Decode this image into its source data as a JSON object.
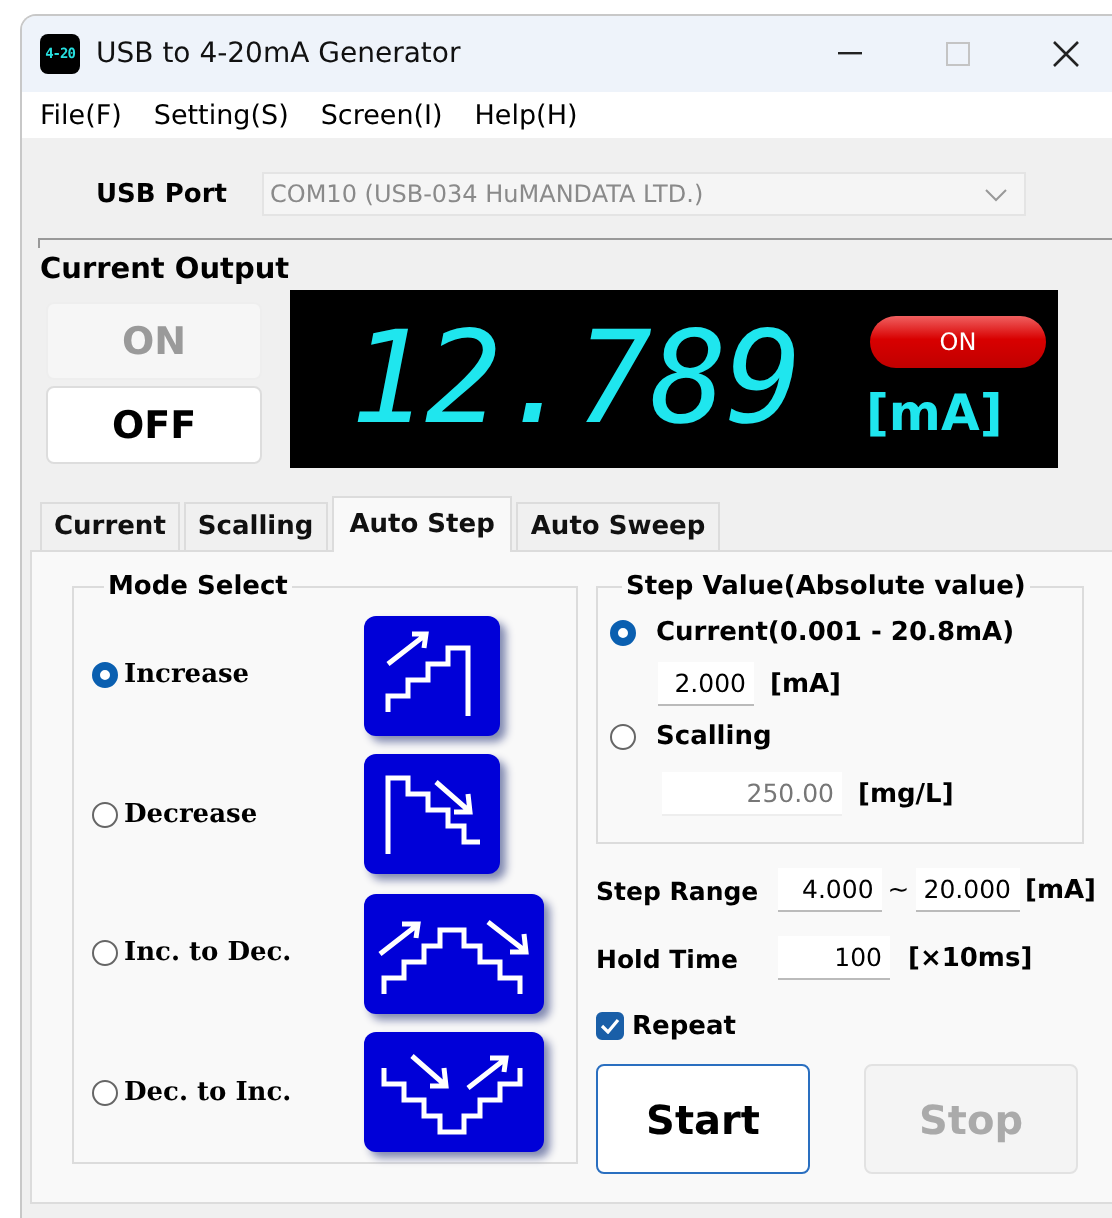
{
  "window": {
    "title": "USB to 4-20mA Generator",
    "icon_text": "4-20"
  },
  "menu": [
    "File(F)",
    "Setting(S)",
    "Screen(I)",
    "Help(H)"
  ],
  "usb_port": {
    "label": "USB Port",
    "value": "COM10 (USB-034 HuMANDATA LTD.)"
  },
  "current_output": {
    "title": "Current Output",
    "buttons": [
      {
        "label": "ON",
        "disabled": true
      },
      {
        "label": "OFF",
        "disabled": false
      }
    ],
    "display": {
      "value": "12.789",
      "unit": "[mA]",
      "indicator": {
        "label": "ON",
        "on": true
      }
    }
  },
  "tabs": [
    {
      "label": "Current",
      "selected": false
    },
    {
      "label": "Scalling",
      "selected": false
    },
    {
      "label": "Auto Step",
      "selected": true
    },
    {
      "label": "Auto Sweep",
      "selected": false
    }
  ],
  "mode_select": {
    "title": "Mode Select",
    "options": [
      {
        "label": "Increase",
        "selected": true,
        "kind": "up"
      },
      {
        "label": "Decrease",
        "selected": false,
        "kind": "down"
      },
      {
        "label": "Inc. to Dec.",
        "selected": false,
        "kind": "peak"
      },
      {
        "label": "Dec. to Inc.",
        "selected": false,
        "kind": "valley"
      }
    ]
  },
  "step_value": {
    "title": "Step Value(Absolute value)",
    "options": [
      {
        "label": "Current(0.001 - 20.8mA)",
        "selected": true,
        "value": "2.000",
        "unit": "[mA]"
      },
      {
        "label": "Scalling",
        "selected": false,
        "value": "250.00",
        "unit": "[mg/L]"
      }
    ]
  },
  "step_range": {
    "label": "Step Range",
    "from": "4.000",
    "separator": "~",
    "to": "20.000",
    "unit": "[mA]"
  },
  "hold_time": {
    "label": "Hold Time",
    "value": "100",
    "unit": "[×10ms]"
  },
  "repeat": {
    "label": "Repeat",
    "checked": true
  },
  "buttons": [
    {
      "label": "Start",
      "disabled": false
    },
    {
      "label": "Stop",
      "disabled": true
    }
  ]
}
